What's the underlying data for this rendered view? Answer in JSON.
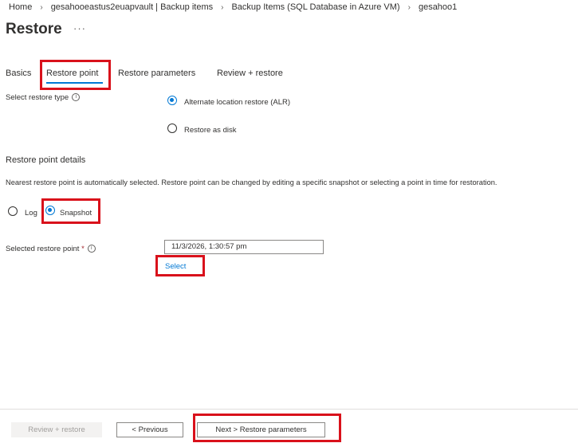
{
  "breadcrumb": [
    "Home",
    "gesahooeastus2euapvault | Backup items",
    "Backup Items (SQL Database in Azure VM)",
    "gesahoo1"
  ],
  "page": {
    "title": "Restore",
    "more": "···"
  },
  "tabs": [
    {
      "label": "Basics"
    },
    {
      "label": "Restore point",
      "active": true
    },
    {
      "label": "Restore parameters"
    },
    {
      "label": "Review + restore"
    }
  ],
  "restore_type": {
    "label": "Select restore type",
    "options": [
      {
        "label": "Alternate location restore (ALR)",
        "selected": true
      },
      {
        "label": "Restore as disk",
        "selected": false
      }
    ]
  },
  "restore_point_details": {
    "heading": "Restore point details",
    "description": "Nearest restore point is automatically selected. Restore point can be changed by editing a specific snapshot or selecting a point in time for restoration.",
    "options": [
      {
        "label": "Log",
        "selected": false
      },
      {
        "label": "Snapshot",
        "selected": true
      }
    ],
    "selected_label": "Selected restore point",
    "required_mark": "*",
    "value": "11/3/2026, 1:30:57 pm",
    "select_link": "Select"
  },
  "footer": {
    "review_restore": "Review + restore",
    "previous": "< Previous",
    "next": "Next > Restore parameters"
  },
  "colors": {
    "accent": "#0078d4",
    "highlight": "#d9111b"
  }
}
